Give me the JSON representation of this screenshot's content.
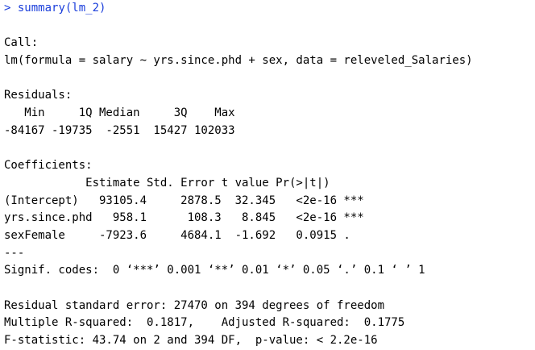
{
  "console": {
    "prompt": ">",
    "command": "summary(lm_2)",
    "colors": {
      "input_text": "#1a3edb",
      "output_text": "#000000",
      "background": "#ffffff"
    },
    "output_lines": [
      "",
      "Call:",
      "lm(formula = salary ~ yrs.since.phd + sex, data = releveled_Salaries)",
      "",
      "Residuals:",
      "   Min     1Q Median     3Q    Max ",
      "-84167 -19735  -2551  15427 102033 ",
      "",
      "Coefficients:",
      "            Estimate Std. Error t value Pr(>|t|)    ",
      "(Intercept)   93105.4     2878.5  32.345   <2e-16 ***",
      "yrs.since.phd   958.1      108.3   8.845   <2e-16 ***",
      "sexFemale     -7923.6     4684.1  -1.692   0.0915 .  ",
      "---",
      "Signif. codes:  0 ‘***’ 0.001 ‘**’ 0.01 ‘*’ 0.05 ‘.’ 0.1 ‘ ’ 1",
      "",
      "Residual standard error: 27470 on 394 degrees of freedom",
      "Multiple R-squared:  0.1817,\tAdjusted R-squared:  0.1775 ",
      "F-statistic: 43.74 on 2 and 394 DF,  p-value: < 2.2e-16"
    ]
  }
}
